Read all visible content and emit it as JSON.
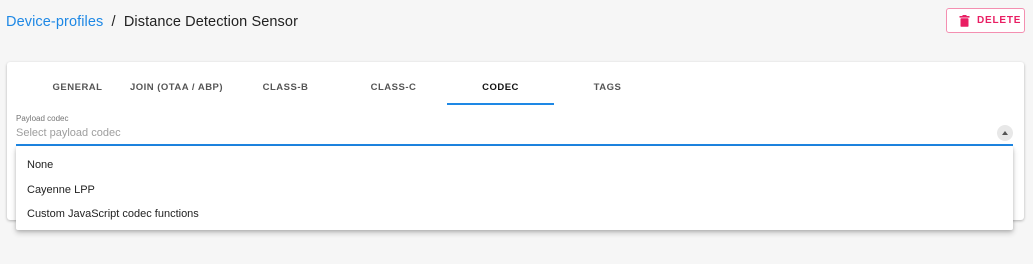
{
  "breadcrumb": {
    "parent": "Device-profiles",
    "separator": "/",
    "current": "Distance Detection Sensor"
  },
  "header": {
    "delete_label": "DELETE",
    "delete_icon": "trash-icon"
  },
  "tabs": [
    {
      "label": "GENERAL"
    },
    {
      "label": "JOIN (OTAA / ABP)"
    },
    {
      "label": "CLASS-B"
    },
    {
      "label": "CLASS-C"
    },
    {
      "label": "CODEC"
    },
    {
      "label": "TAGS"
    }
  ],
  "active_tab": "CODEC",
  "payload_codec": {
    "label": "Payload codec",
    "placeholder": "Select payload codec",
    "arrow_icon": "arrow-up-icon",
    "options": [
      {
        "label": "None"
      },
      {
        "label": "Cayenne LPP"
      },
      {
        "label": "Custom JavaScript codec functions"
      }
    ]
  },
  "colors": {
    "accent": "#1e88e5",
    "danger": "#e91e63",
    "danger_border": "#f48fb1"
  }
}
